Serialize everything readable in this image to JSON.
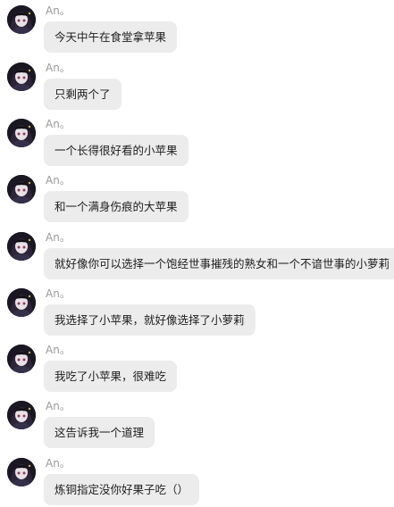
{
  "colors": {
    "bubble_background": "#ececec",
    "sender_text": "#9a9a9a",
    "message_text": "#1e1e1e",
    "page_background": "#ffffff"
  },
  "avatar_icon": "anime-girl-avatar-icon",
  "messages": [
    {
      "sender": "An。",
      "text": "今天中午在食堂拿苹果"
    },
    {
      "sender": "An。",
      "text": "只剩两个了"
    },
    {
      "sender": "An。",
      "text": "一个长得很好看的小苹果"
    },
    {
      "sender": "An。",
      "text": "和一个满身伤痕的大苹果"
    },
    {
      "sender": "An。",
      "text": "就好像你可以选择一个饱经世事摧残的熟女和一个不谙世事的小萝莉"
    },
    {
      "sender": "An。",
      "text": "我选择了小苹果，就好像选择了小萝莉"
    },
    {
      "sender": "An。",
      "text": "我吃了小苹果，很难吃"
    },
    {
      "sender": "An。",
      "text": "这告诉我一个道理"
    },
    {
      "sender": "An。",
      "text": "炼铜指定没你好果子吃（）"
    }
  ]
}
